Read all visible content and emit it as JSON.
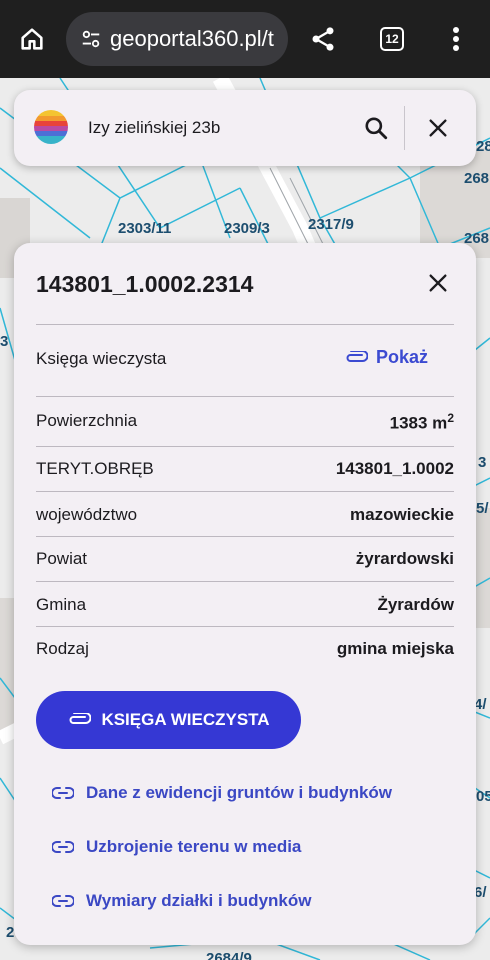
{
  "browser": {
    "url": "geoportal360.pl/t",
    "tab_count": "12"
  },
  "map": {
    "labels": [
      "2303/11",
      "2309/3",
      "2317/9",
      "268",
      "268",
      "28",
      "2684/9",
      "3",
      "3",
      "5/",
      "4/",
      "05",
      "6/",
      "2"
    ]
  },
  "search": {
    "query": "Izy zielińskiej 23b"
  },
  "parcel": {
    "id": "143801_1.0002.2314",
    "land_register_label": "Księga wieczysta",
    "land_register_link": "Pokaż",
    "rows": [
      {
        "label": "Powierzchnia",
        "value": "1383 m",
        "unit_sup": "2"
      },
      {
        "label": "TERYT.OBRĘB",
        "value": "143801_1.0002"
      },
      {
        "label": "województwo",
        "value": "mazowieckie"
      },
      {
        "label": "Powiat",
        "value": "żyrardowski"
      },
      {
        "label": "Gmina",
        "value": "Żyrardów"
      },
      {
        "label": "Rodzaj",
        "value": "gmina miejska"
      }
    ],
    "primary_button": "KSIĘGA WIECZYSTA",
    "links": [
      "Dane z ewidencji gruntów i budynków",
      "Uzbrojenie terenu w media",
      "Wymiary działki i budynków"
    ]
  },
  "colors": {
    "accent": "#3538d4",
    "link": "#3b48c4",
    "card_bg": "#f3eff4",
    "parcel_line": "#31b8d8",
    "map_label": "#1d4e6f"
  }
}
